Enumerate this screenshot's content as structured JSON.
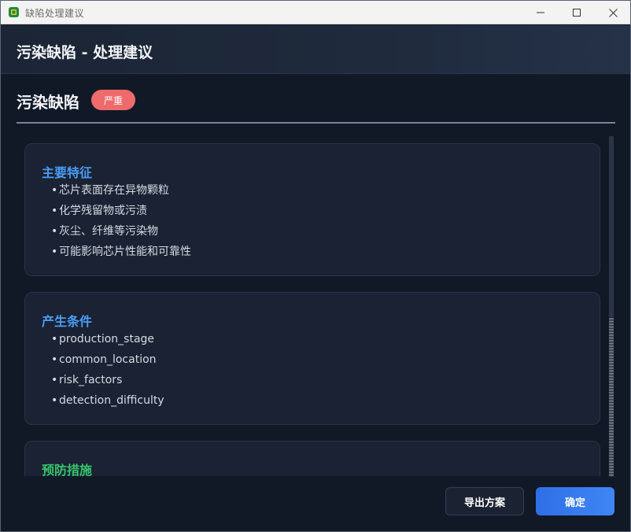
{
  "window": {
    "title": "缺陷处理建议"
  },
  "header": {
    "title": "污染缺陷 - 处理建议"
  },
  "defect": {
    "name": "污染缺陷",
    "severity": "严重"
  },
  "sections": [
    {
      "title": "主要特征",
      "items": [
        "芯片表面存在异物颗粒",
        "化学残留物或污渍",
        "灰尘、纤维等污染物",
        "可能影响芯片性能和可靠性"
      ]
    },
    {
      "title": "产生条件",
      "items": [
        "production_stage",
        "common_location",
        "risk_factors",
        "detection_difficulty"
      ]
    },
    {
      "title": "预防措施",
      "items": []
    }
  ],
  "footer": {
    "export_label": "导出方案",
    "confirm_label": "确定"
  },
  "colors": {
    "accent_blue": "#4b9cf5",
    "accent_green": "#35c46b",
    "severity_red": "#ef6b6b",
    "confirm_button": "#3f86f5"
  },
  "icons": {
    "app": "chip-icon",
    "minimize": "minimize-icon",
    "maximize": "maximize-icon",
    "close": "close-icon"
  }
}
